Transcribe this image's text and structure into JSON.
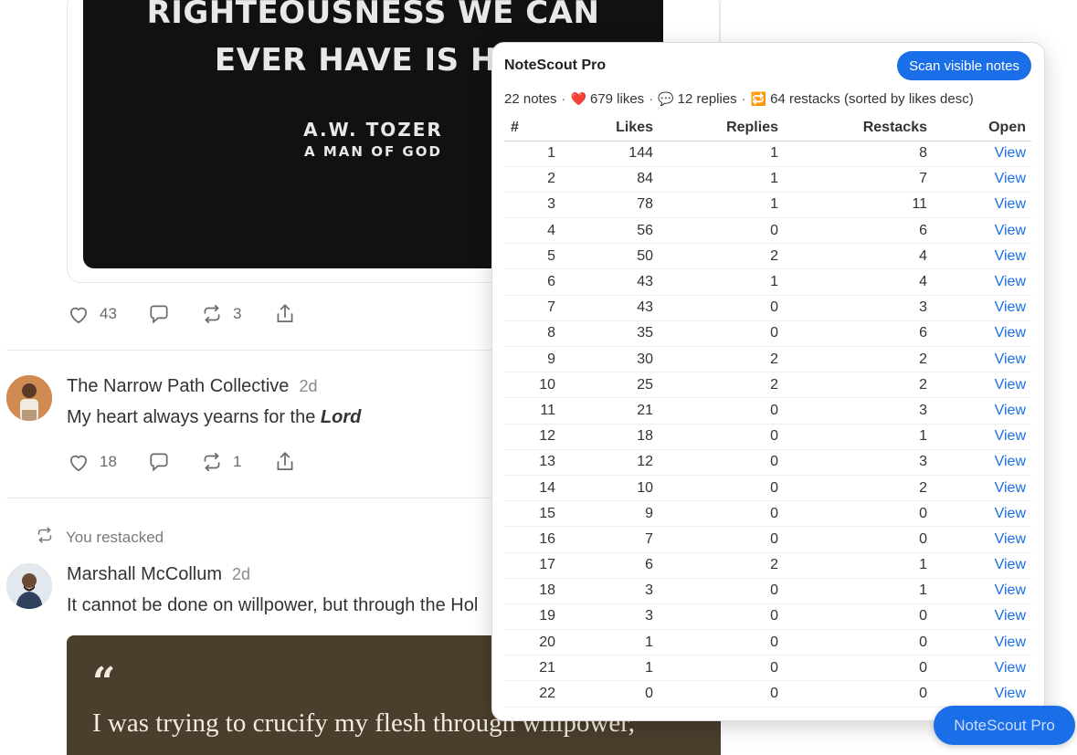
{
  "feed": {
    "quote_image": {
      "line1": "RIGHTEOUSNESS WE CAN",
      "line2": "EVER HAVE IS HIS",
      "author": "A.W. TOZER",
      "subtitle": "A MAN OF GOD"
    },
    "post1_actions": {
      "likes": "43",
      "restacks": "3"
    },
    "post2": {
      "author": "The Narrow Path Collective",
      "time": "2d",
      "text_prefix": "My heart always yearns for the ",
      "text_emphasis": "Lord",
      "likes": "18",
      "restacks": "1"
    },
    "restack_notice": "You restacked",
    "post3": {
      "author": "Marshall McCollum",
      "time": "2d",
      "text": "It cannot be done on willpower, but through the Hol",
      "quote_marks": "“",
      "quote_text": "I was trying to crucify my flesh through willpower,"
    }
  },
  "panel": {
    "title": "NoteScout Pro",
    "scan_button": "Scan visible notes",
    "summary": {
      "notes": "22 notes",
      "likes_icon": "❤️",
      "likes": "679 likes",
      "replies_icon": "💬",
      "replies": "12 replies",
      "restacks_icon": "🔁",
      "restacks": "64 restacks (sorted by likes desc)",
      "separator": "·"
    },
    "columns": [
      "#",
      "Likes",
      "Replies",
      "Restacks",
      "Open"
    ],
    "rows": [
      {
        "n": "1",
        "likes": "144",
        "replies": "1",
        "restacks": "8",
        "open": "View"
      },
      {
        "n": "2",
        "likes": "84",
        "replies": "1",
        "restacks": "7",
        "open": "View"
      },
      {
        "n": "3",
        "likes": "78",
        "replies": "1",
        "restacks": "11",
        "open": "View"
      },
      {
        "n": "4",
        "likes": "56",
        "replies": "0",
        "restacks": "6",
        "open": "View"
      },
      {
        "n": "5",
        "likes": "50",
        "replies": "2",
        "restacks": "4",
        "open": "View"
      },
      {
        "n": "6",
        "likes": "43",
        "replies": "1",
        "restacks": "4",
        "open": "View"
      },
      {
        "n": "7",
        "likes": "43",
        "replies": "0",
        "restacks": "3",
        "open": "View"
      },
      {
        "n": "8",
        "likes": "35",
        "replies": "0",
        "restacks": "6",
        "open": "View"
      },
      {
        "n": "9",
        "likes": "30",
        "replies": "2",
        "restacks": "2",
        "open": "View"
      },
      {
        "n": "10",
        "likes": "25",
        "replies": "2",
        "restacks": "2",
        "open": "View"
      },
      {
        "n": "11",
        "likes": "21",
        "replies": "0",
        "restacks": "3",
        "open": "View"
      },
      {
        "n": "12",
        "likes": "18",
        "replies": "0",
        "restacks": "1",
        "open": "View"
      },
      {
        "n": "13",
        "likes": "12",
        "replies": "0",
        "restacks": "3",
        "open": "View"
      },
      {
        "n": "14",
        "likes": "10",
        "replies": "0",
        "restacks": "2",
        "open": "View"
      },
      {
        "n": "15",
        "likes": "9",
        "replies": "0",
        "restacks": "0",
        "open": "View"
      },
      {
        "n": "16",
        "likes": "7",
        "replies": "0",
        "restacks": "0",
        "open": "View"
      },
      {
        "n": "17",
        "likes": "6",
        "replies": "2",
        "restacks": "1",
        "open": "View"
      },
      {
        "n": "18",
        "likes": "3",
        "replies": "0",
        "restacks": "1",
        "open": "View"
      },
      {
        "n": "19",
        "likes": "3",
        "replies": "0",
        "restacks": "0",
        "open": "View"
      },
      {
        "n": "20",
        "likes": "1",
        "replies": "0",
        "restacks": "0",
        "open": "View"
      },
      {
        "n": "21",
        "likes": "1",
        "replies": "0",
        "restacks": "0",
        "open": "View"
      },
      {
        "n": "22",
        "likes": "0",
        "replies": "0",
        "restacks": "0",
        "open": "View"
      }
    ]
  },
  "floating_button": "NoteScout Pro",
  "colors": {
    "accent": "#1a6ee8",
    "quote_bg": "#4a3e2c",
    "image_bg": "#111111"
  },
  "icons": [
    "heart-icon",
    "comment-icon",
    "restack-icon",
    "share-icon"
  ]
}
